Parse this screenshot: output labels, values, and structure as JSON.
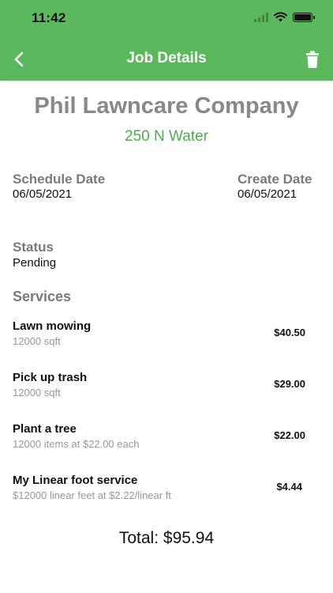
{
  "status_bar": {
    "time": "11:42"
  },
  "nav": {
    "title": "Job Details"
  },
  "company": {
    "name": "Phil Lawncare Company",
    "address": "250 N Water"
  },
  "schedule_date": {
    "label": "Schedule Date",
    "value": "06/05/2021"
  },
  "create_date": {
    "label": "Create Date",
    "value": "06/05/2021"
  },
  "status": {
    "label": "Status",
    "value": "Pending"
  },
  "services": {
    "label": "Services",
    "items": [
      {
        "name": "Lawn mowing",
        "detail": "12000 sqft",
        "price": "$40.50"
      },
      {
        "name": "Pick up trash",
        "detail": "12000 sqft",
        "price": "$29.00"
      },
      {
        "name": "Plant a tree",
        "detail": "12000 items at $22.00 each",
        "price": "$22.00"
      },
      {
        "name": "My Linear foot service",
        "detail": "$12000 linear feet at $2.22/linear ft",
        "price": "$4.44"
      }
    ]
  },
  "total": "Total: $95.94",
  "colors": {
    "header": "#5cb85c",
    "accent": "#4caf50",
    "label": "#7a7a7a"
  },
  "icons": [
    "signal-icon",
    "wifi-icon",
    "battery-icon",
    "back-chevron-icon",
    "trash-icon"
  ]
}
